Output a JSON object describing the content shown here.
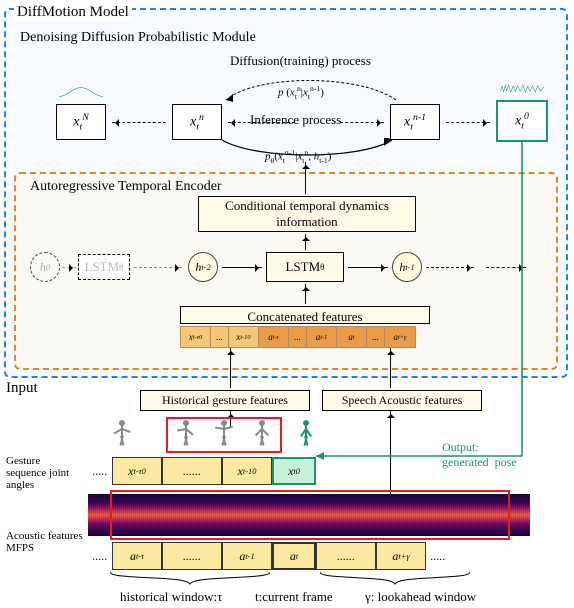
{
  "model_title": "DiffMotion Model",
  "diffusion": {
    "title": "Denoising Diffusion Probabilistic Module",
    "forward_label": "Diffusion(training) process",
    "forward_dist": "p (x_t^n | x_t^{n-1})",
    "inference_label": "Inference process",
    "inference_dist": "p_θ(x_t^{n-1} | x_t^n, h_{t-1})",
    "boxes": {
      "xN": "x_t^N",
      "xn": "x_t^n",
      "xnm1": "x_t^{n-1}",
      "x0": "x_t^0"
    }
  },
  "encoder": {
    "title": "Autoregressive Temporal Encoder",
    "cond_label": "Conditional temporal dynamics information",
    "lstm_theta": "LSTM_θ",
    "lstm_phantom": "LSTM_θ",
    "h0": "h_0",
    "htm2": "h_{t-2}",
    "htm1": "h_{t-1}",
    "concat_label": "Concatenated features",
    "concat_cells": [
      "x_{t-τ}^0",
      "...",
      "x_{t-1}^0",
      "a_{t-τ}",
      "...",
      "a_{t-1}",
      "a_t",
      "...",
      "a_{t+γ}"
    ]
  },
  "input": {
    "section": "Input",
    "hist_box": "Historical gesture features",
    "speech_box": "Speech Acoustic features",
    "output_label": "Output: generated  pose",
    "gesture_side": "Gesture sequence joint angles",
    "acoustic_side": "Acoustic features MFPS",
    "x_cells": [
      "x_{t-τ}^0",
      "......",
      "x_{t-1}^0"
    ],
    "xt_cell": "x_t^0",
    "a_cells_left": [
      "a_{t-τ}",
      "......",
      "a_{t-1}"
    ],
    "a_t": "a_t",
    "a_cells_right": [
      "......",
      "a_{t+γ}"
    ],
    "dots": ".....",
    "dots_wide": "......",
    "hist_window": "historical window:τ",
    "current": "t:current frame",
    "lookahead": "γ: lookahead window"
  }
}
